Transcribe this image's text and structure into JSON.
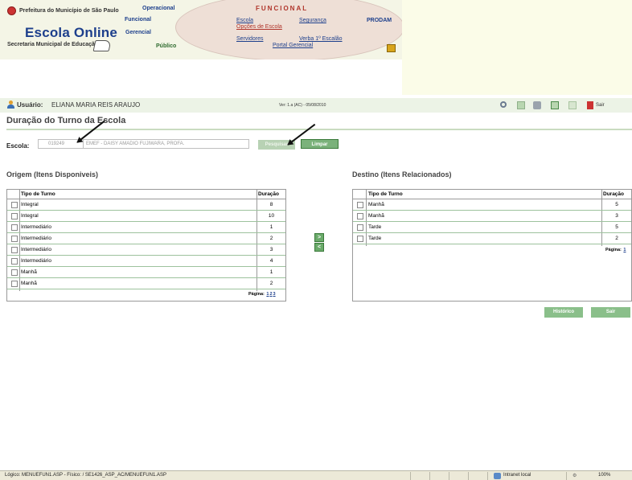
{
  "header": {
    "prefeitura": "Prefeitura do Município de São Paulo",
    "app_name": "Escola Online",
    "secretaria": "Secretaria Municipal de Educação",
    "menu_operacional": "Operacional",
    "menu_funcional": "Funcional",
    "menu_gerencial": "Gerencial",
    "menu_publico": "Público",
    "section": "FUNCIONAL",
    "links": {
      "escola": "Escola",
      "opcoes": "Opções de Escola",
      "servidores": "Servidores",
      "seguranca": "Segurança",
      "verba": "Verba 1º Escalão",
      "portal": "Portal Gerencial"
    },
    "prodam": "PRODAM"
  },
  "userbar": {
    "label": "Usuário:",
    "name": "ELIANA MARIA REIS ARAUJO",
    "version": "Ver: 1.a (AC) - 05/08/2010",
    "sair": "Sair"
  },
  "page_title": "Duração do Turno da Escola",
  "escola": {
    "label": "Escola:",
    "code": "019249",
    "name": "EMEF - DAISY AMADIO FUJIWARA, PROFA.",
    "btn_pesquisar": "Pesquisar",
    "btn_limpar": "Limpar"
  },
  "origem": {
    "title": "Origem (Itens Disponiveis)",
    "col_tipo": "Tipo de Turno",
    "col_duracao": "Duração",
    "rows": [
      {
        "tipo": "Integral",
        "duracao": "8"
      },
      {
        "tipo": "Integral",
        "duracao": "10"
      },
      {
        "tipo": "Intermediário",
        "duracao": "1"
      },
      {
        "tipo": "Intermediário",
        "duracao": "2"
      },
      {
        "tipo": "Intermediário",
        "duracao": "3"
      },
      {
        "tipo": "Intermediário",
        "duracao": "4"
      },
      {
        "tipo": "Manhã",
        "duracao": "1"
      },
      {
        "tipo": "Manhã",
        "duracao": "2"
      }
    ],
    "pagina_label": "Página:",
    "pages": [
      "1",
      "2",
      "3"
    ]
  },
  "destino": {
    "title": "Destino (Itens Relacionados)",
    "col_tipo": "Tipo de Turno",
    "col_duracao": "Duração",
    "rows": [
      {
        "tipo": "Manhã",
        "duracao": "5"
      },
      {
        "tipo": "Manhã",
        "duracao": "3"
      },
      {
        "tipo": "Tarde",
        "duracao": "5"
      },
      {
        "tipo": "Tarde",
        "duracao": "2"
      }
    ],
    "pagina_label": "Página:",
    "pages": [
      "1"
    ]
  },
  "move": {
    "add": ">",
    "remove": "<"
  },
  "buttons": {
    "historico": "Histórico",
    "sair": "Sair"
  },
  "statusbar": {
    "text": "Lógico: MENUEFUN1.ASP - Físico: / SE1426_ASP_AC/MENUEFUN1.ASP",
    "zone": "Intranet local",
    "zoom": "100%"
  }
}
